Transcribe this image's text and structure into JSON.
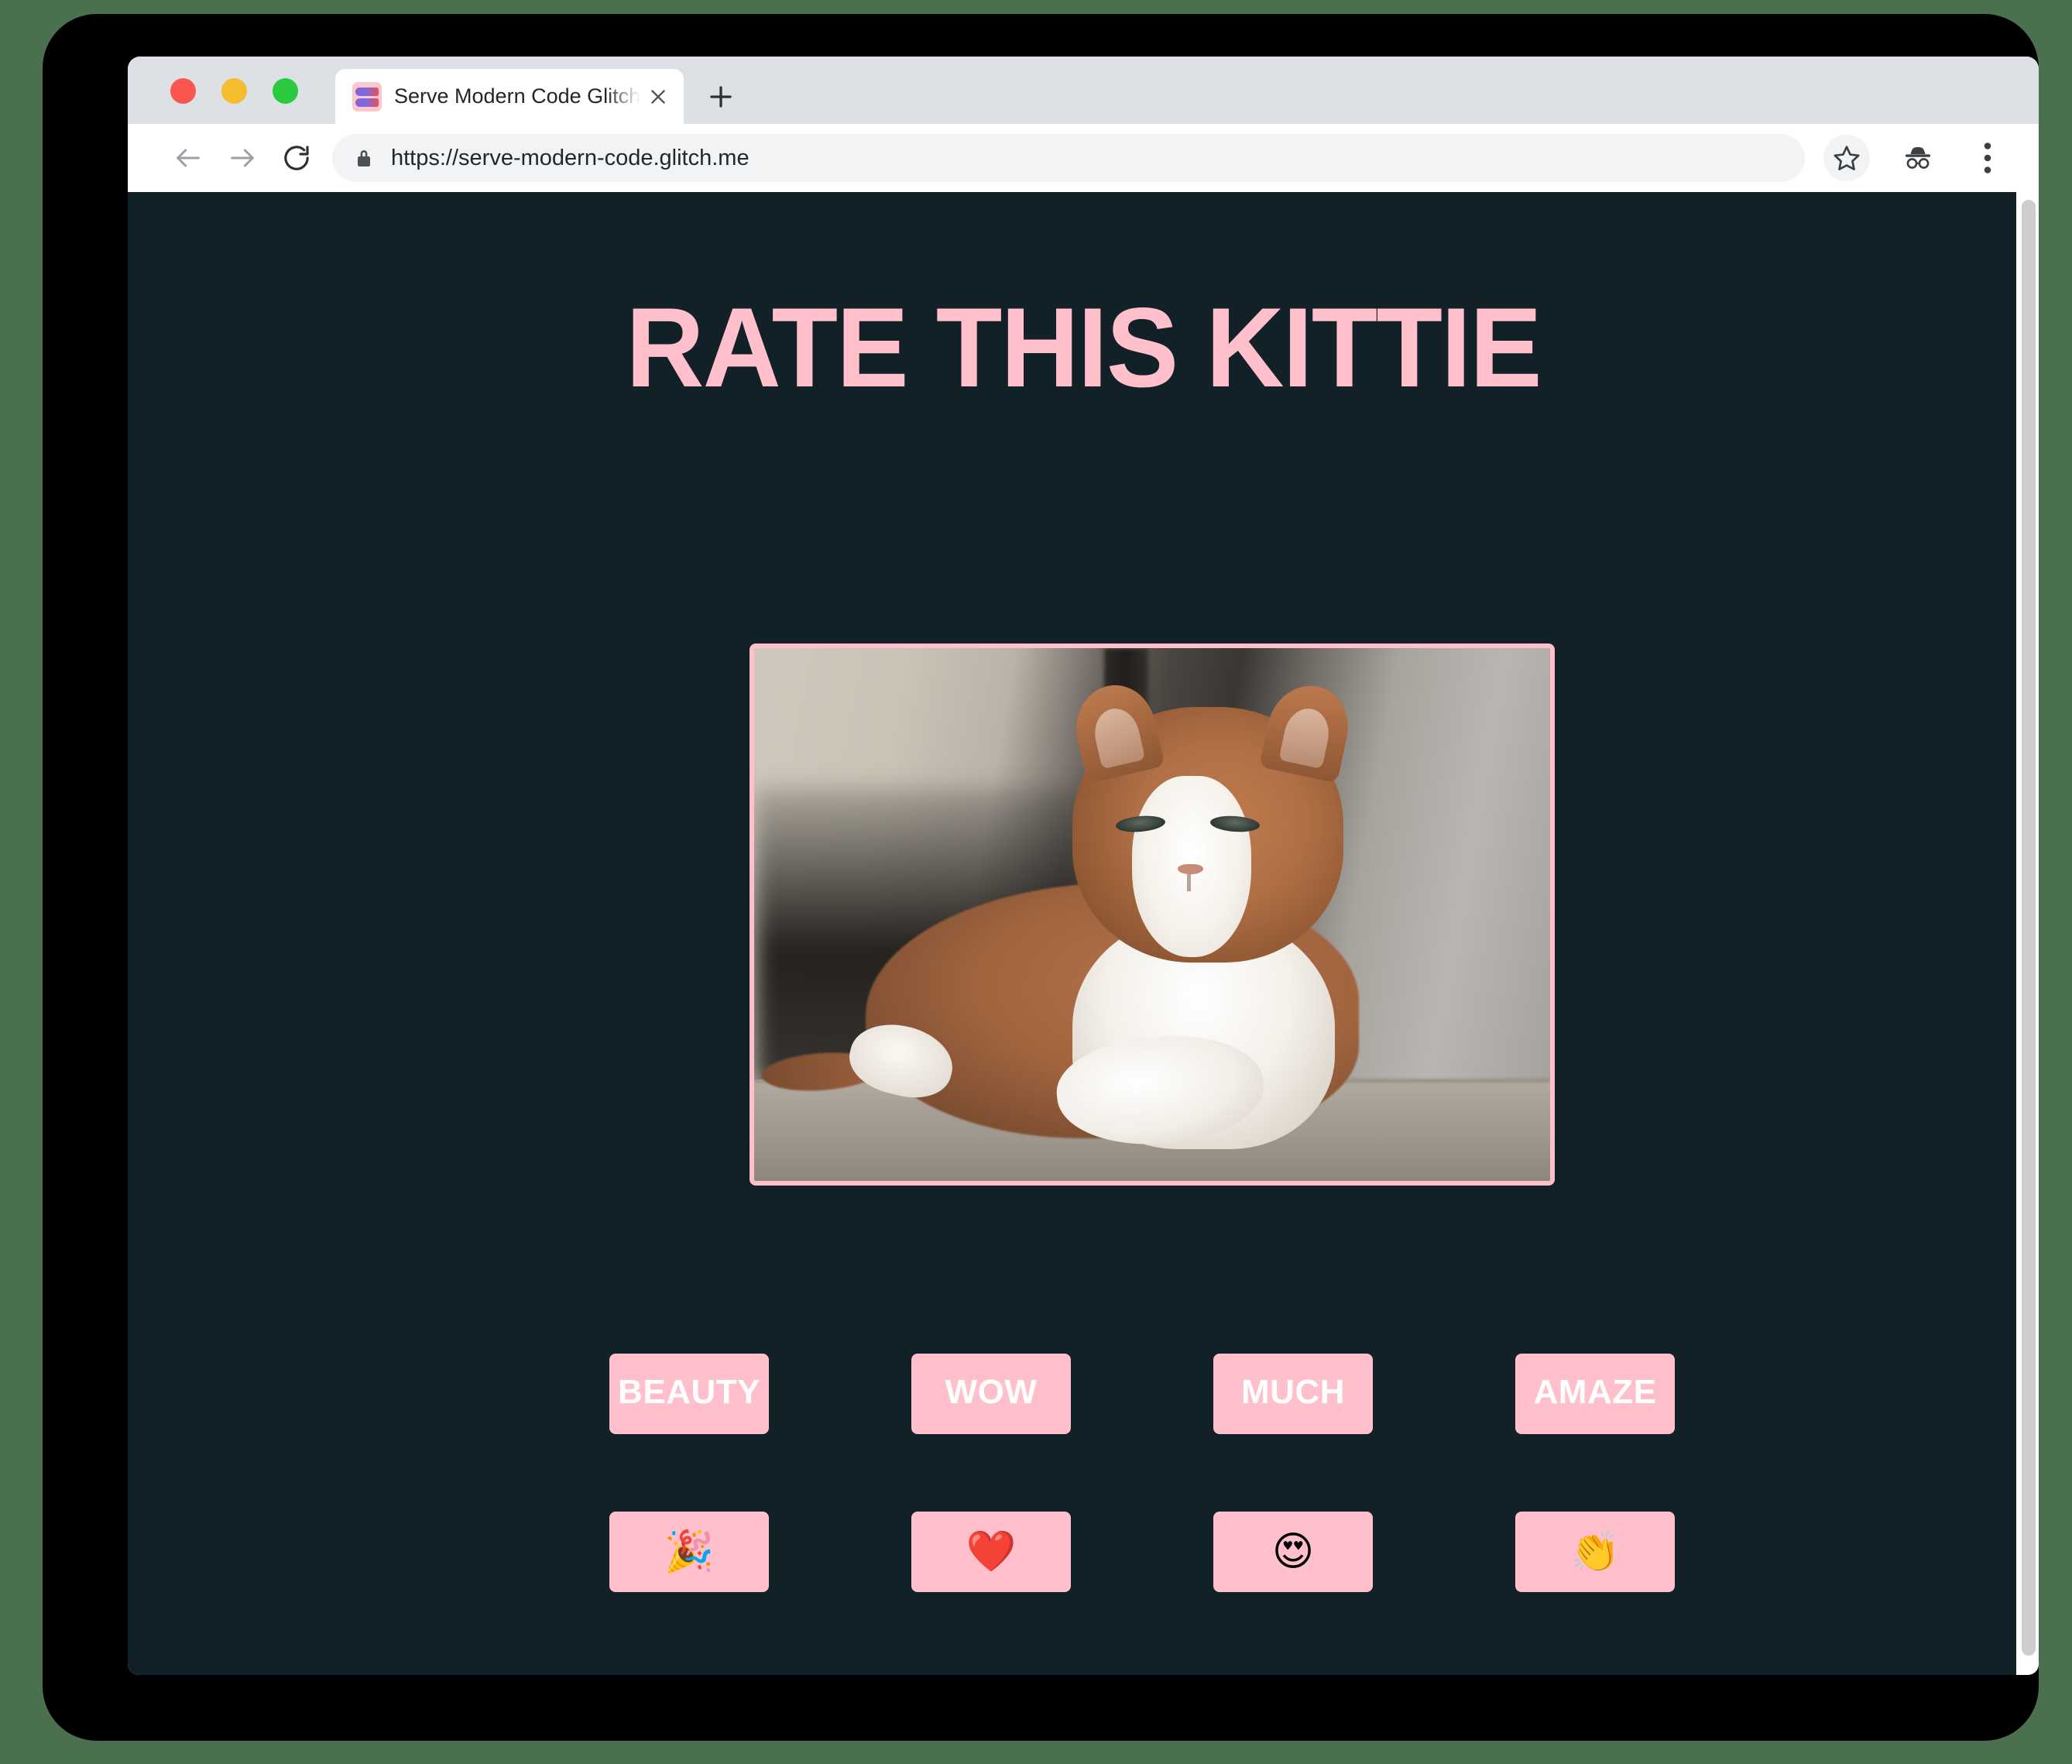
{
  "browser": {
    "tab": {
      "title": "Serve Modern Code Glitch Play",
      "favicon_name": "fish-favicon",
      "close_label": "✕"
    },
    "new_tab_label": "＋",
    "toolbar": {
      "back_label": "←",
      "forward_label": "→",
      "reload_label": "⟳",
      "lock_label": "🔒",
      "url": "https://serve-modern-code.glitch.me",
      "bookmark_label": "☆",
      "incognito_label": "incognito",
      "menu_label": "⋮"
    },
    "traffic_lights": [
      "close",
      "minimize",
      "maximize"
    ]
  },
  "page": {
    "title": "RATE THIS KITTIE",
    "image_alt": "Orange and white tabby cat lying on a floor",
    "word_buttons": [
      "BEAUTY",
      "WOW",
      "MUCH",
      "AMAZE"
    ],
    "emoji_buttons": [
      {
        "name": "party-popper",
        "glyph": "🎉"
      },
      {
        "name": "red-heart",
        "glyph": "❤️"
      },
      {
        "name": "heart-eyes",
        "glyph": "😍"
      },
      {
        "name": "clapping-hands",
        "glyph": "👏"
      }
    ]
  },
  "colors": {
    "page_background": "#122028",
    "accent_pink": "#ffc0cb",
    "desktop_green": "#4a7050",
    "button_text": "#ffffff"
  }
}
